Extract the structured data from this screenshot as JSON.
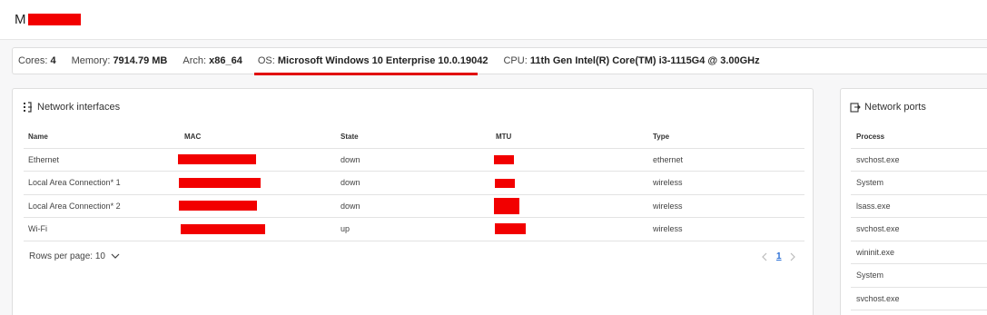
{
  "header": {
    "title": "M"
  },
  "sysinfo": {
    "cores_label": "Cores:",
    "cores": "4",
    "memory_label": "Memory:",
    "memory": "7914.79 MB",
    "arch_label": "Arch:",
    "arch": "x86_64",
    "os_label": "OS:",
    "os": "Microsoft Windows 10 Enterprise 10.0.19042",
    "cpu_label": "CPU:",
    "cpu": "11th Gen Intel(R) Core(TM) i3-1115G4 @ 3.00GHz"
  },
  "network": {
    "title": "Network interfaces",
    "columns": [
      "Name",
      "MAC",
      "State",
      "MTU",
      "Type"
    ],
    "rows": [
      {
        "name": "Ethernet",
        "state": "down",
        "mtu": "",
        "type": "ethernet"
      },
      {
        "name": "Local Area Connection* 1",
        "state": "down",
        "mtu": "",
        "type": "wireless"
      },
      {
        "name": "Local Area Connection* 2",
        "state": "down",
        "mtu": "",
        "type": "wireless"
      },
      {
        "name": "Wi-Fi",
        "state": "up",
        "mtu": "",
        "type": "wireless"
      }
    ],
    "rows_per_page_label": "Rows per page: 10",
    "page": "1"
  },
  "ports": {
    "title": "Network ports",
    "columns": [
      "Process"
    ],
    "rows": [
      "svchost.exe",
      "System",
      "lsass.exe",
      "svchost.exe",
      "wininit.exe",
      "System",
      "svchost.exe"
    ]
  },
  "colors": {
    "redaction": "#f20000",
    "link": "#2a6fd6"
  },
  "icons": {
    "network_interfaces": "network-list-icon",
    "network_ports": "port-export-icon"
  }
}
